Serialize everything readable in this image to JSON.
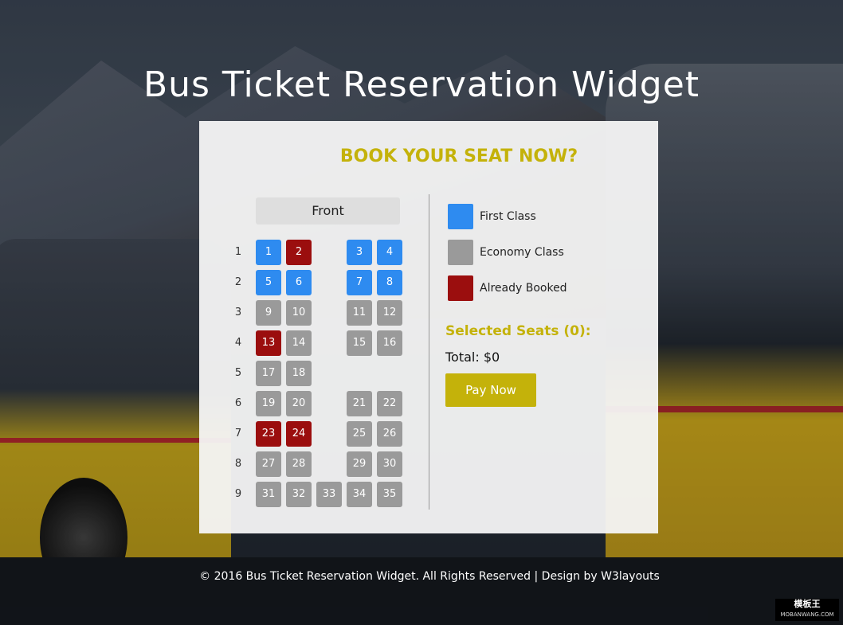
{
  "page": {
    "title": "Bus Ticket Reservation Widget",
    "footer": "© 2016 Bus Ticket Reservation Widget. All Rights Reserved | Design by W3layouts"
  },
  "card": {
    "heading": "BOOK YOUR SEAT NOW?",
    "front_label": "Front"
  },
  "rows": [
    {
      "label": "1",
      "seats": [
        {
          "n": "1",
          "t": "first"
        },
        {
          "n": "2",
          "t": "booked"
        },
        null,
        {
          "n": "3",
          "t": "first"
        },
        {
          "n": "4",
          "t": "first"
        }
      ]
    },
    {
      "label": "2",
      "seats": [
        {
          "n": "5",
          "t": "first"
        },
        {
          "n": "6",
          "t": "first"
        },
        null,
        {
          "n": "7",
          "t": "first"
        },
        {
          "n": "8",
          "t": "first"
        }
      ]
    },
    {
      "label": "3",
      "seats": [
        {
          "n": "9",
          "t": "economy"
        },
        {
          "n": "10",
          "t": "economy"
        },
        null,
        {
          "n": "11",
          "t": "economy"
        },
        {
          "n": "12",
          "t": "economy"
        }
      ]
    },
    {
      "label": "4",
      "seats": [
        {
          "n": "13",
          "t": "booked"
        },
        {
          "n": "14",
          "t": "economy"
        },
        null,
        {
          "n": "15",
          "t": "economy"
        },
        {
          "n": "16",
          "t": "economy"
        }
      ]
    },
    {
      "label": "5",
      "seats": [
        {
          "n": "17",
          "t": "economy"
        },
        {
          "n": "18",
          "t": "economy"
        },
        null,
        null,
        null
      ]
    },
    {
      "label": "6",
      "seats": [
        {
          "n": "19",
          "t": "economy"
        },
        {
          "n": "20",
          "t": "economy"
        },
        null,
        {
          "n": "21",
          "t": "economy"
        },
        {
          "n": "22",
          "t": "economy"
        }
      ]
    },
    {
      "label": "7",
      "seats": [
        {
          "n": "23",
          "t": "booked"
        },
        {
          "n": "24",
          "t": "booked"
        },
        null,
        {
          "n": "25",
          "t": "economy"
        },
        {
          "n": "26",
          "t": "economy"
        }
      ]
    },
    {
      "label": "8",
      "seats": [
        {
          "n": "27",
          "t": "economy"
        },
        {
          "n": "28",
          "t": "economy"
        },
        null,
        {
          "n": "29",
          "t": "economy"
        },
        {
          "n": "30",
          "t": "economy"
        }
      ]
    },
    {
      "label": "9",
      "seats": [
        {
          "n": "31",
          "t": "economy"
        },
        {
          "n": "32",
          "t": "economy"
        },
        {
          "n": "33",
          "t": "economy"
        },
        {
          "n": "34",
          "t": "economy"
        },
        {
          "n": "35",
          "t": "economy"
        }
      ]
    }
  ],
  "legend": [
    {
      "label": "First Class",
      "color": "#2e8bf0"
    },
    {
      "label": "Economy Class",
      "color": "#9a9a9a"
    },
    {
      "label": "Already Booked",
      "color": "#9b0e0e"
    }
  ],
  "summary": {
    "selected_title": "Selected Seats (0):",
    "total": "Total: $0",
    "pay_label": "Pay Now"
  },
  "watermark": {
    "top": "模板王",
    "bottom": "MOBANWANG.COM"
  },
  "colors": {
    "first": "#2e8bf0",
    "economy": "#9a9a9a",
    "booked": "#9b0e0e",
    "accent": "#c4b20a"
  }
}
